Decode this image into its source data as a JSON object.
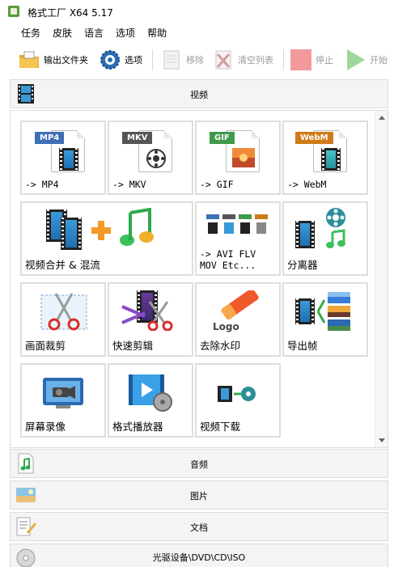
{
  "window": {
    "title": "格式工厂 X64 5.17"
  },
  "menu": [
    "任务",
    "皮肤",
    "语言",
    "选项",
    "帮助"
  ],
  "toolbar": {
    "output_folder": "输出文件夹",
    "options": "选项",
    "remove": "移除",
    "clear_list": "清空列表",
    "stop": "停止",
    "start": "开始"
  },
  "categories": {
    "video": "视频",
    "audio": "音频",
    "image": "图片",
    "document": "文档",
    "optical": "光驱设备\\DVD\\CD\\ISO"
  },
  "tiles": {
    "mp4": {
      "badge": "MP4",
      "label": "-> MP4"
    },
    "mkv": {
      "badge": "MKV",
      "label": "-> MKV"
    },
    "gif": {
      "badge": "GIF",
      "label": "-> GIF"
    },
    "webm": {
      "badge": "WebM",
      "label": "-> WebM"
    },
    "merge": {
      "label": "视频合并 & 混流"
    },
    "avi": {
      "label": "-> AVI FLV\nMOV Etc..."
    },
    "separator": {
      "label": "分离器"
    },
    "crop": {
      "label": "画面裁剪"
    },
    "quick_cut": {
      "label": "快速剪辑"
    },
    "watermark": {
      "label": "去除水印",
      "logo_text": "Logo"
    },
    "export_frames": {
      "label": "导出帧"
    },
    "screen_record": {
      "label": "屏幕录像"
    },
    "player": {
      "label": "格式播放器"
    },
    "download": {
      "label": "视频下载"
    }
  },
  "colors": {
    "mp4": "#3f6fb6",
    "mkv": "#555555",
    "gif": "#3f9a4a",
    "webm": "#d07a1a",
    "stop": "#f29a9a",
    "start": "#9fd89a"
  }
}
